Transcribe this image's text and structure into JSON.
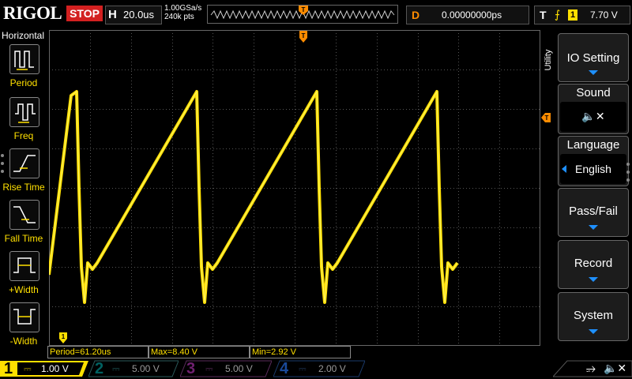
{
  "top": {
    "logo": "RIGOL",
    "run_state": "STOP",
    "timebase_letter": "H",
    "timebase": "20.0us",
    "sample_rate": "1.00GSa/s",
    "memory_depth": "240k pts",
    "trigger_marker": "T",
    "delay_letter": "D",
    "delay": "0.00000000ps",
    "trig_letter": "T",
    "trig_edge": "⨍",
    "trig_source": "1",
    "trig_level": "7.70 V"
  },
  "left_panel": {
    "title": "Horizontal",
    "items": [
      {
        "label": "Period",
        "icon": "period-icon"
      },
      {
        "label": "Freq",
        "icon": "freq-icon"
      },
      {
        "label": "Rise Time",
        "icon": "rise-time-icon"
      },
      {
        "label": "Fall Time",
        "icon": "fall-time-icon"
      },
      {
        "label": "+Width",
        "icon": "plus-width-icon"
      },
      {
        "label": "-Width",
        "icon": "minus-width-icon"
      }
    ]
  },
  "right_panel": {
    "tab_label": "Utility",
    "buttons": [
      {
        "label": "IO Setting",
        "sub": ""
      },
      {
        "label": "Sound",
        "sub": "🔈✕"
      },
      {
        "label": "Language",
        "sub": "English"
      },
      {
        "label": "Pass/Fail",
        "sub": ""
      },
      {
        "label": "Record",
        "sub": ""
      },
      {
        "label": "System",
        "sub": ""
      }
    ]
  },
  "measurements": {
    "period": "Period=61.20us",
    "max": "Max=8.40 V",
    "min": "Min=2.92 V"
  },
  "channels": [
    {
      "num": "1",
      "scale": "1.00 V",
      "color": "#ffe000",
      "active": true
    },
    {
      "num": "2",
      "scale": "5.00 V",
      "color": "#00c8c8",
      "active": false
    },
    {
      "num": "3",
      "scale": "5.00 V",
      "color": "#d040d0",
      "active": false
    },
    {
      "num": "4",
      "scale": "2.00 V",
      "color": "#1e6cff",
      "active": false
    }
  ],
  "colors": {
    "trace": "#ffe000",
    "trigger": "#ff8c00",
    "grid": "#555555"
  }
}
